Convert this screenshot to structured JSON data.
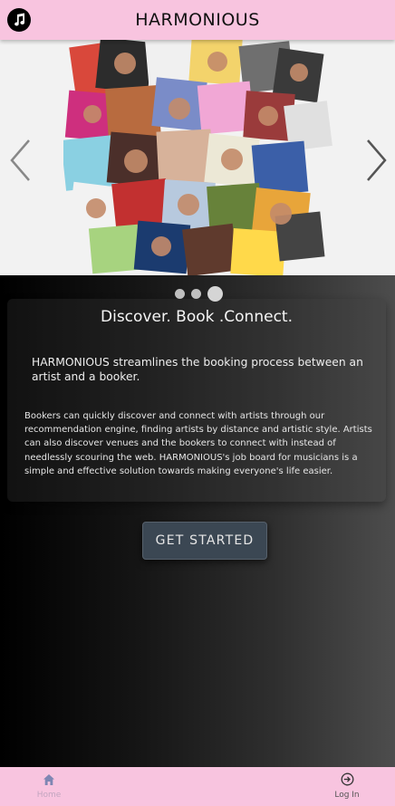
{
  "header": {
    "title": "HARMONIOUS",
    "logo_icon": "music-note-icon"
  },
  "carousel": {
    "image_description": "collage-of-artist-portraits",
    "prev_icon": "chevron-left-icon",
    "next_icon": "chevron-right-icon",
    "slide_count": 3,
    "active_slide": 3
  },
  "intro": {
    "tagline": "Discover. Book .Connect.",
    "lead": "HARMONIOUS streamlines the booking process between an artist and a booker.",
    "body": "Bookers can quickly discover and connect with artists through our recommendation engine, finding artists by distance and artistic style. Artists can also discover venues and the bookers to connect with instead of needlessly scouring the web. HARMONIOUS's job board for musicians is a simple and effective solution towards making everyone's life easier."
  },
  "cta": {
    "label": "GET STARTED"
  },
  "tabs": [
    {
      "label": "Home",
      "icon": "home-icon",
      "active": true
    },
    {
      "label": "Log In",
      "icon": "login-icon",
      "active": false
    }
  ],
  "colors": {
    "brand_pink": "#f8c4df",
    "button_bg": "#3b4753",
    "active_tab_icon": "#7f86b3"
  }
}
